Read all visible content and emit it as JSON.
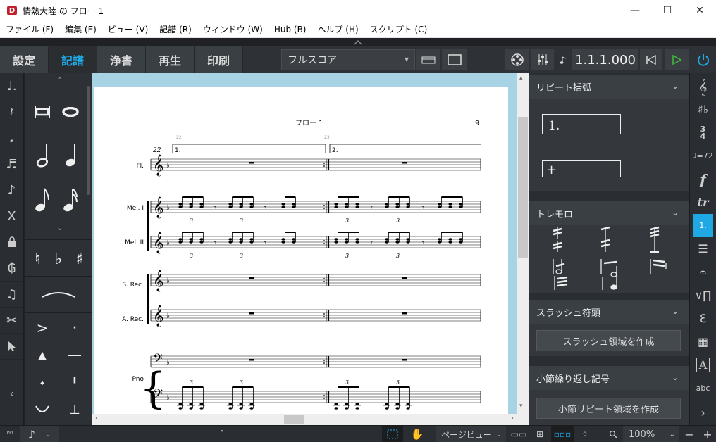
{
  "window": {
    "title": "情熱大陸 の フロー 1",
    "minimize": "—",
    "maximize": "☐",
    "close": "✕"
  },
  "menu": [
    "ファイル (F)",
    "編集 (E)",
    "ビュー (V)",
    "記譜 (R)",
    "ウィンドウ (W)",
    "Hub (B)",
    "ヘルプ (H)",
    "スクリプト (C)"
  ],
  "modes": [
    "設定",
    "記譜",
    "浄書",
    "再生",
    "印刷"
  ],
  "active_mode": "記譜",
  "layout_select": "フルスコア",
  "transport": {
    "time": "1.1.1.000"
  },
  "score": {
    "flow_title": "フロー 1",
    "page_number": "9",
    "bar_start": "22",
    "bar_numbers": [
      "22",
      "23"
    ],
    "endings": [
      "1.",
      "2."
    ],
    "instruments": [
      "Fl.",
      "Mel. I",
      "Mel. II",
      "S. Rec.",
      "A. Rec.",
      "Pno"
    ],
    "tuplet": "3"
  },
  "right_panel": {
    "sections": [
      {
        "title": "リピート括弧",
        "items": [
          "1.",
          "+"
        ]
      },
      {
        "title": "トレモロ"
      },
      {
        "title": "スラッシュ符頭",
        "button": "スラッシュ領域を作成"
      },
      {
        "title": "小節繰り返し記号",
        "button": "小節リピート領域を作成"
      }
    ]
  },
  "right_tools": [
    "treble-clef",
    "key-signature",
    "time-signature",
    "tempo",
    "dynamics",
    "ornaments",
    "repeat-endings",
    "tremolo",
    "fermata",
    "bar-repeats",
    "playing-techniques",
    "holds",
    "text",
    "lyrics"
  ],
  "right_tool_labels": {
    "time_sig_top": "3",
    "time_sig_bottom": "4",
    "tempo": "♩=72",
    "dyn": "f",
    "trill": "tr",
    "ending": "1.",
    "lyrics": "abc"
  },
  "status": {
    "view_mode": "ページビュー",
    "zoom": "100%",
    "note_input": "♪"
  }
}
